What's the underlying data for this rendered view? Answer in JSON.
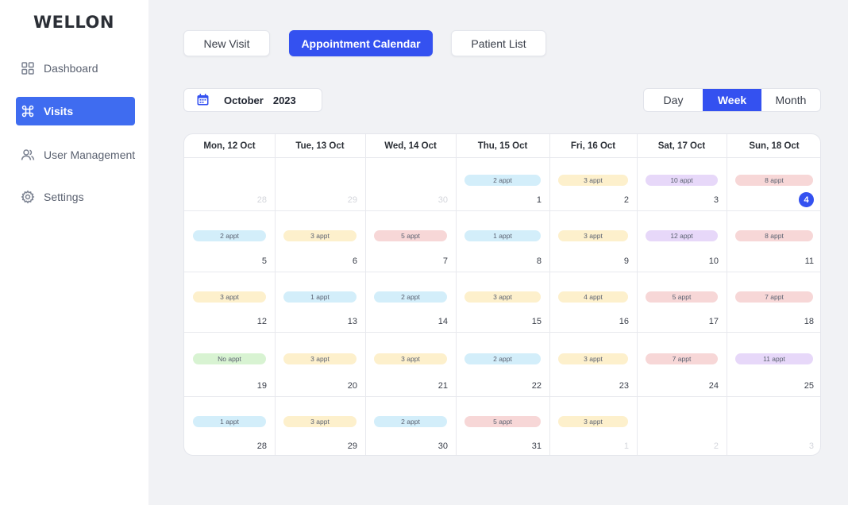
{
  "brand": {
    "logo": "WELLON"
  },
  "sidebar": {
    "items": [
      {
        "label": "Dashboard",
        "icon": "grid-icon",
        "active": false
      },
      {
        "label": "Visits",
        "icon": "command-icon",
        "active": true
      },
      {
        "label": "User Management",
        "icon": "users-icon",
        "active": false
      },
      {
        "label": "Settings",
        "icon": "gear-icon",
        "active": false
      }
    ]
  },
  "toolbar": {
    "new_visit": "New Visit",
    "appointment_calendar": "Appointment Calendar",
    "patient_list": "Patient List"
  },
  "date_picker": {
    "month": "October",
    "year": "2023",
    "icon": "calendar-icon"
  },
  "view_toggle": {
    "day": "Day",
    "week": "Week",
    "month": "Month",
    "selected": "Week"
  },
  "colors": {
    "accent": "#3451f0",
    "blue": "#d3eefa",
    "yellow": "#fdf0cc",
    "purple": "#e7d8f9",
    "red": "#f7d7d7",
    "green": "#d8f3d2"
  },
  "calendar": {
    "columns": [
      "Mon, 12 Oct",
      "Tue, 13 Oct",
      "Wed, 14 Oct",
      "Thu, 15 Oct",
      "Fri, 16 Oct",
      "Sat, 17 Oct",
      "Sun, 18 Oct"
    ],
    "weeks": [
      [
        {
          "day": "28",
          "muted": true
        },
        {
          "day": "29",
          "muted": true
        },
        {
          "day": "30",
          "muted": true
        },
        {
          "day": "1",
          "appt": "2 appt",
          "color": "blue"
        },
        {
          "day": "2",
          "appt": "3 appt",
          "color": "yellow"
        },
        {
          "day": "3",
          "appt": "10 appt",
          "color": "purple"
        },
        {
          "day": "4",
          "appt": "8 appt",
          "color": "red",
          "today": true
        }
      ],
      [
        {
          "day": "5",
          "appt": "2 appt",
          "color": "blue"
        },
        {
          "day": "6",
          "appt": "3 appt",
          "color": "yellow"
        },
        {
          "day": "7",
          "appt": "5 appt",
          "color": "red"
        },
        {
          "day": "8",
          "appt": "1 appt",
          "color": "blue"
        },
        {
          "day": "9",
          "appt": "3 appt",
          "color": "yellow"
        },
        {
          "day": "10",
          "appt": "12 appt",
          "color": "purple"
        },
        {
          "day": "11",
          "appt": "8 appt",
          "color": "red"
        }
      ],
      [
        {
          "day": "12",
          "appt": "3 appt",
          "color": "yellow"
        },
        {
          "day": "13",
          "appt": "1 appt",
          "color": "blue"
        },
        {
          "day": "14",
          "appt": "2 appt",
          "color": "blue"
        },
        {
          "day": "15",
          "appt": "3 appt",
          "color": "yellow"
        },
        {
          "day": "16",
          "appt": "4 appt",
          "color": "yellow"
        },
        {
          "day": "17",
          "appt": "5 appt",
          "color": "red"
        },
        {
          "day": "18",
          "appt": "7 appt",
          "color": "red"
        }
      ],
      [
        {
          "day": "19",
          "appt": "No appt",
          "color": "green"
        },
        {
          "day": "20",
          "appt": "3 appt",
          "color": "yellow"
        },
        {
          "day": "21",
          "appt": "3 appt",
          "color": "yellow"
        },
        {
          "day": "22",
          "appt": "2 appt",
          "color": "blue"
        },
        {
          "day": "23",
          "appt": "3 appt",
          "color": "yellow"
        },
        {
          "day": "24",
          "appt": "7 appt",
          "color": "red"
        },
        {
          "day": "25",
          "appt": "11 appt",
          "color": "purple"
        }
      ],
      [
        {
          "day": "28",
          "appt": "1 appt",
          "color": "blue"
        },
        {
          "day": "29",
          "appt": "3 appt",
          "color": "yellow"
        },
        {
          "day": "30",
          "appt": "2 appt",
          "color": "blue"
        },
        {
          "day": "31",
          "appt": "5 appt",
          "color": "red"
        },
        {
          "day": "1",
          "appt": "3 appt",
          "color": "yellow",
          "muted": true
        },
        {
          "day": "2",
          "muted": true
        },
        {
          "day": "3",
          "muted": true
        }
      ]
    ]
  }
}
